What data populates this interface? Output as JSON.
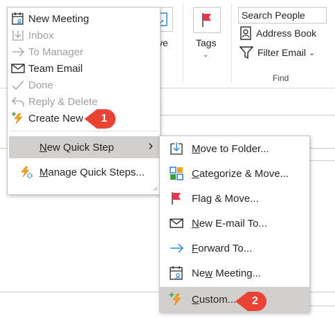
{
  "ribbon": {
    "move_label": "ve",
    "tags_label": "Tags",
    "tags_caret": "⌄",
    "search_placeholder": "Search People",
    "address_book": "Address Book",
    "filter_email": "Filter Email",
    "filter_caret": "⌄",
    "find_group": "Find"
  },
  "menu": {
    "items": [
      {
        "label": "New Meeting",
        "icon": "calendar-icon",
        "enabled": true
      },
      {
        "label": "Inbox",
        "icon": "move-to-folder-icon",
        "enabled": false
      },
      {
        "label": "To Manager",
        "icon": "arrow-right-icon",
        "enabled": false
      },
      {
        "label": "Team Email",
        "icon": "envelope-icon",
        "enabled": true
      },
      {
        "label": "Done",
        "icon": "checkmark-icon",
        "enabled": false
      },
      {
        "label": "Reply & Delete",
        "icon": "reply-icon",
        "enabled": false
      },
      {
        "label": "Create New",
        "icon": "lightning-plus-icon",
        "enabled": true
      }
    ],
    "new_quick_step": {
      "prefix": "",
      "mnemonic": "N",
      "rest": "ew Quick Step",
      "chevron": "›"
    },
    "manage_quick_steps": {
      "mnemonic": "M",
      "rest": "anage Quick Steps..."
    },
    "grip": "⠴"
  },
  "callouts": {
    "one": "1",
    "two": "2"
  },
  "submenu": {
    "items": [
      {
        "mnemonic": "M",
        "rest": "ove to Folder...",
        "icon": "move-to-folder-icon"
      },
      {
        "mnemonic": "C",
        "rest": "ategorize & Move...",
        "icon": "categorize-icon"
      },
      {
        "prefix": "Fla",
        "mnemonic": "g",
        "rest": " & Move...",
        "icon": "flag-icon"
      },
      {
        "mnemonic": "N",
        "rest": "ew E-mail To...",
        "icon": "envelope-icon"
      },
      {
        "mnemonic": "F",
        "rest": "orward To...",
        "icon": "arrow-right-icon"
      },
      {
        "prefix": "Ne",
        "mnemonic": "w",
        "rest": " Meeting...",
        "icon": "calendar-icon"
      },
      {
        "mnemonic": "C",
        "rest": "ustom...",
        "icon": "lightning-plus-icon"
      }
    ]
  },
  "colors": {
    "accent_blue": "#2b88d8",
    "callout_red": "#ea4335",
    "flag_red": "#e8364a",
    "highlight": "#d2d0ce"
  }
}
